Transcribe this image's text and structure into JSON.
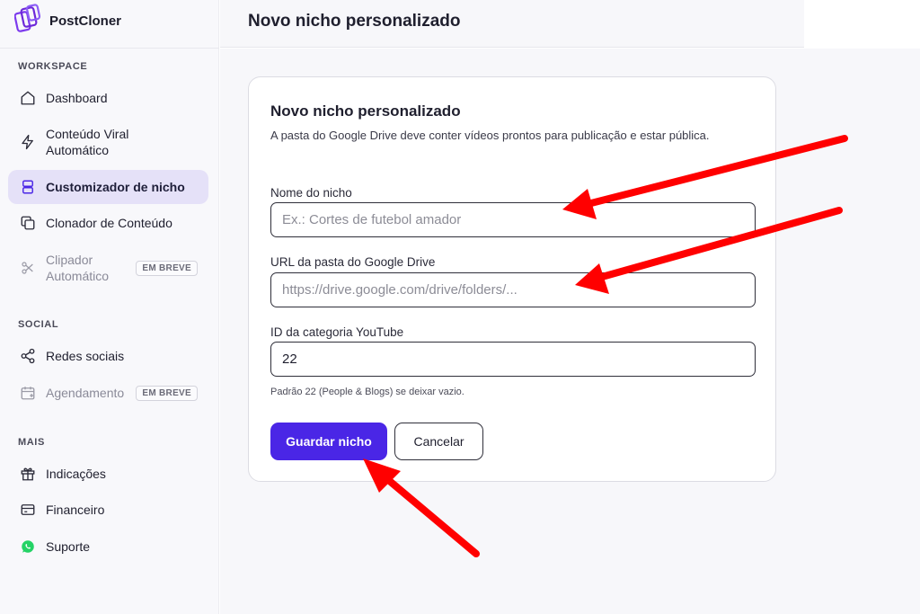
{
  "app": {
    "name": "PostCloner"
  },
  "sidebar": {
    "sections": [
      {
        "label": "WORKSPACE"
      },
      {
        "label": "SOCIAL"
      },
      {
        "label": "MAIS"
      }
    ],
    "items": [
      {
        "label": "Dashboard",
        "icon": "home-icon"
      },
      {
        "label": "Conteúdo Viral Automático",
        "icon": "lightning-icon"
      },
      {
        "label": "Customizador de nicho",
        "icon": "layout-icon",
        "active": true
      },
      {
        "label": "Clonador de Conteúdo",
        "icon": "copy-icon"
      },
      {
        "label": "Clipador Automático",
        "icon": "scissors-icon",
        "badge": "EM BREVE",
        "disabled": true
      },
      {
        "label": "Redes sociais",
        "icon": "share-icon"
      },
      {
        "label": "Agendamento",
        "icon": "calendar-icon",
        "badge": "EM BREVE",
        "disabled": true
      },
      {
        "label": "Indicações",
        "icon": "gift-icon"
      },
      {
        "label": "Financeiro",
        "icon": "credit-card-icon"
      },
      {
        "label": "Suporte",
        "icon": "whatsapp-icon"
      }
    ]
  },
  "header": {
    "title": "Novo nicho personalizado"
  },
  "form": {
    "title": "Novo nicho personalizado",
    "description": "A pasta do Google Drive deve conter vídeos prontos para publicação e estar pública.",
    "fields": {
      "name": {
        "label": "Nome do nicho",
        "placeholder": "Ex.: Cortes de futebol amador",
        "value": ""
      },
      "drive_url": {
        "label": "URL da pasta do Google Drive",
        "placeholder": "https://drive.google.com/drive/folders/...",
        "value": ""
      },
      "category": {
        "label": "ID da categoria YouTube",
        "placeholder": "",
        "value": "22"
      }
    },
    "hint": "Padrão 22 (People & Blogs) se deixar vazio.",
    "save_label": "Guardar nicho",
    "cancel_label": "Cancelar"
  },
  "colors": {
    "accent": "#4a26e6",
    "active_nav_bg": "#e5e1f8",
    "annotation_arrow": "#ff0000",
    "support_icon": "#25d366"
  }
}
